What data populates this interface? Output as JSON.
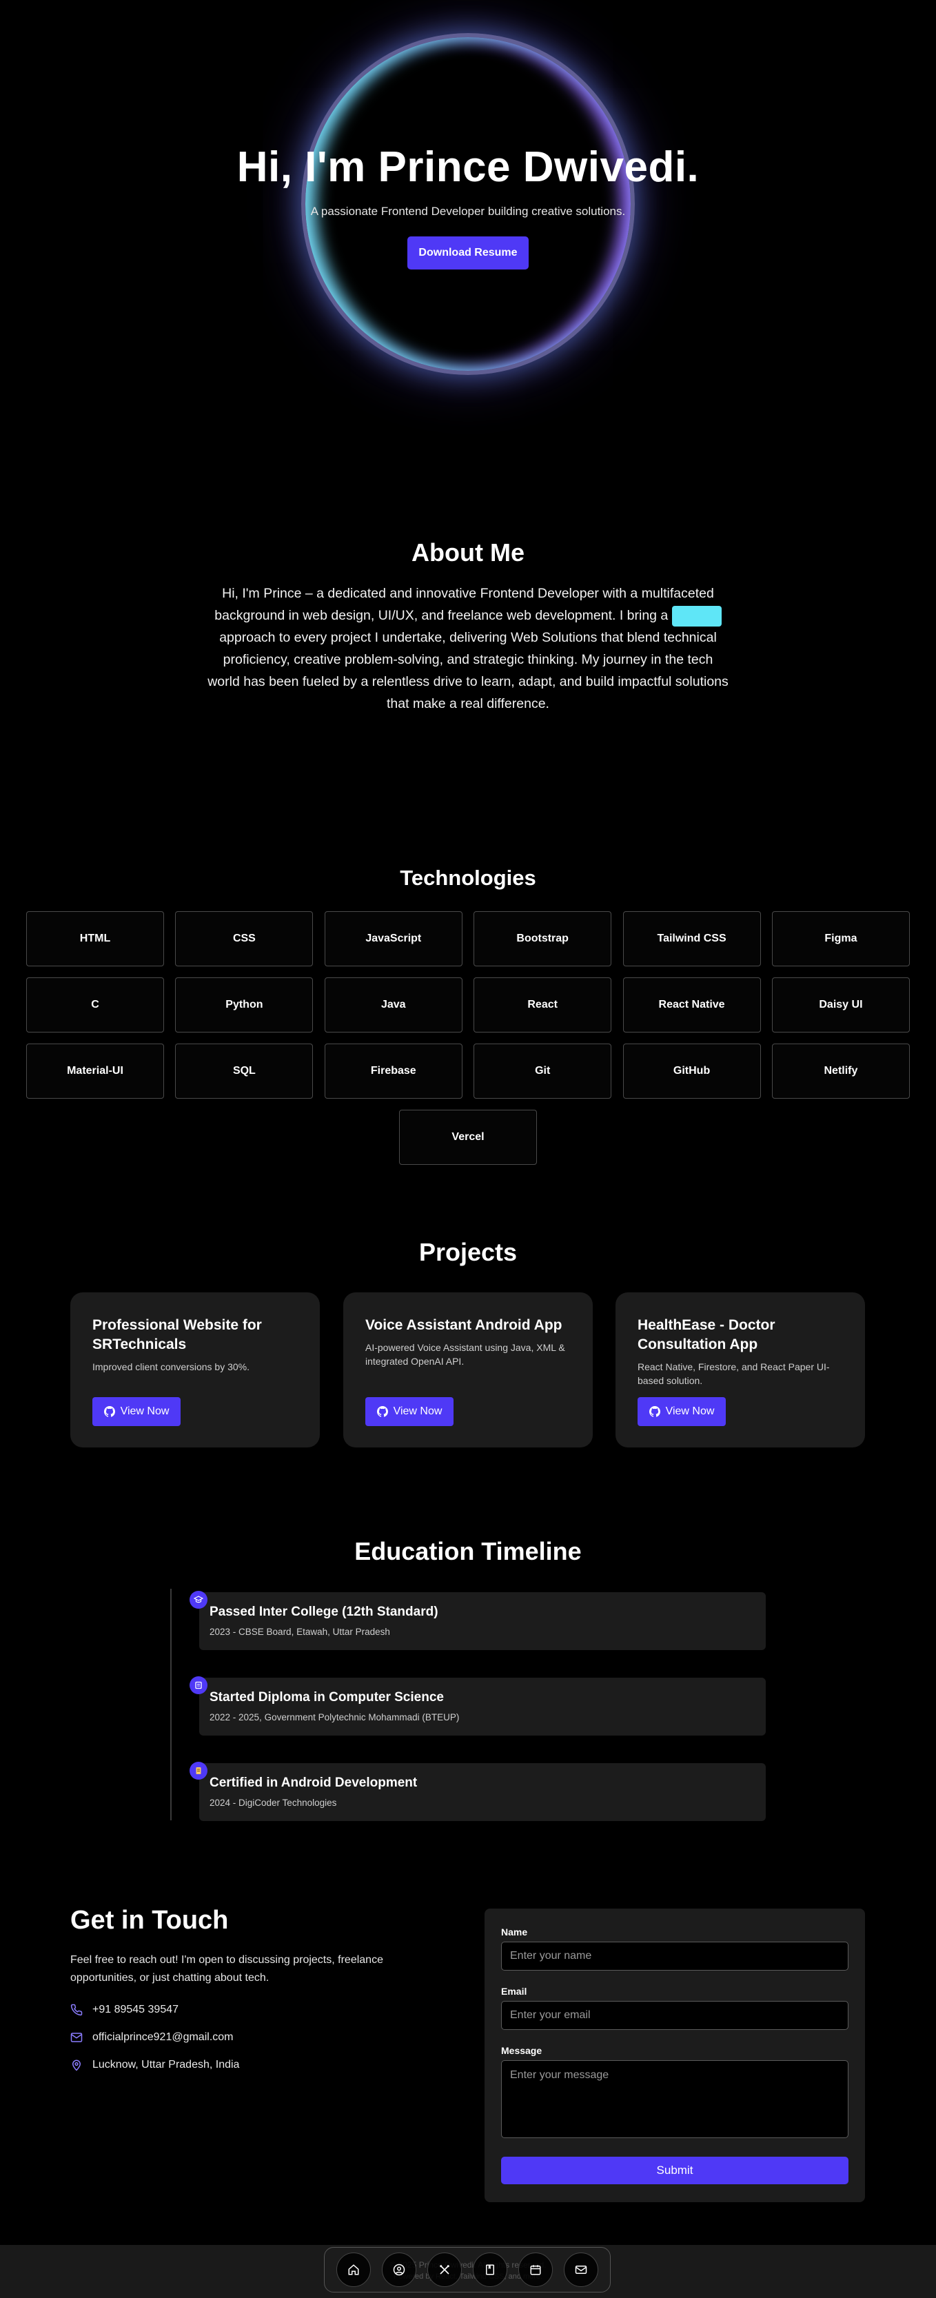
{
  "hero": {
    "title": "Hi, I'm Prince Dwivedi.",
    "subtitle": "A passionate Frontend Developer building creative solutions.",
    "button": "Download Resume"
  },
  "about": {
    "title": "About Me",
    "text_before": "Hi, I'm Prince – a dedicated and innovative Frontend Developer with a multifaceted background in web design, UI/UX, and freelance web development. I bring a",
    "text_after": "approach to every project I undertake, delivering Web Solutions that blend technical proficiency, creative problem-solving, and strategic thinking. My journey in the tech world has been fueled by a relentless drive to learn, adapt, and build impactful solutions that make a real difference."
  },
  "technologies": {
    "title": "Technologies",
    "items": [
      "HTML",
      "CSS",
      "JavaScript",
      "Bootstrap",
      "Tailwind CSS",
      "Figma",
      "C",
      "Python",
      "Java",
      "React",
      "React Native",
      "Daisy UI",
      "Material-UI",
      "SQL",
      "Firebase",
      "Git",
      "GitHub",
      "Netlify",
      "Vercel"
    ]
  },
  "projects": {
    "title": "Projects",
    "items": [
      {
        "title": "Professional Website for SRTechnicals",
        "desc": "Improved client conversions by 30%.",
        "button": "View Now"
      },
      {
        "title": "Voice Assistant Android App",
        "desc": "AI-powered Voice Assistant using Java, XML & integrated OpenAI API.",
        "button": "View Now"
      },
      {
        "title": "HealthEase - Doctor Consultation App",
        "desc": "React Native, Firestore, and React Paper UI-based solution.",
        "button": "View Now"
      }
    ]
  },
  "education": {
    "title": "Education Timeline",
    "items": [
      {
        "title": "Passed Inter College (12th Standard)",
        "sub": "2023 - CBSE Board, Etawah, Uttar Pradesh"
      },
      {
        "title": "Started Diploma in Computer Science",
        "sub": "2022 - 2025, Government Polytechnic Mohammadi (BTEUP)"
      },
      {
        "title": "Certified in Android Development",
        "sub": "2024 - DigiCoder Technologies"
      }
    ]
  },
  "contact": {
    "title": "Get in Touch",
    "desc": "Feel free to reach out! I'm open to discussing projects, freelance opportunities, or just chatting about tech.",
    "phone": "+91 89545 39547",
    "email": "officialprince921@gmail.com",
    "location": "Lucknow, Uttar Pradesh, India",
    "form": {
      "name_label": "Name",
      "name_placeholder": "Enter your name",
      "email_label": "Email",
      "email_placeholder": "Enter your email",
      "message_label": "Message",
      "message_placeholder": "Enter your message",
      "submit": "Submit"
    }
  },
  "footer": {
    "line1": "© 2025 Prince Dwivedi. All rights reserved.",
    "line2": "Powered by React, Tailwind CSS, and more."
  },
  "dock": {
    "icons": [
      "home-icon",
      "user-icon",
      "tools-icon",
      "book-icon",
      "calendar-icon",
      "mail-icon"
    ]
  },
  "colors": {
    "accent": "#4f39f6",
    "highlight": "#5fe6f7",
    "card": "#1c1c1c"
  }
}
